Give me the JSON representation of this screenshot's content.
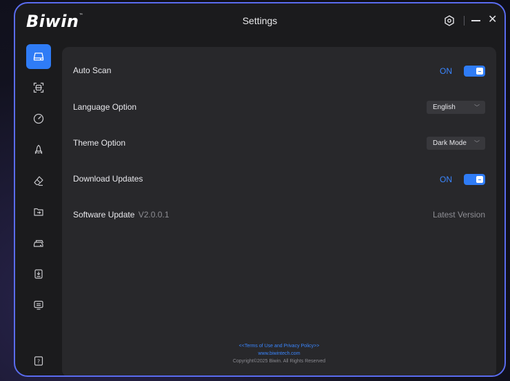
{
  "app": {
    "logo": "Biwin",
    "logo_tm": "™",
    "title": "Settings"
  },
  "titlebar": {
    "gear_icon": "gear-icon",
    "minimize_label": "—",
    "close_label": "✕"
  },
  "sidebar": {
    "items": [
      {
        "icon": "drive-icon",
        "active": true
      },
      {
        "icon": "scan-icon",
        "active": false
      },
      {
        "icon": "speed-gauge-icon",
        "active": false
      },
      {
        "icon": "rocket-icon",
        "active": false
      },
      {
        "icon": "eraser-icon",
        "active": false
      },
      {
        "icon": "folder-transfer-icon",
        "active": false
      },
      {
        "icon": "drive-clone-icon",
        "active": false
      },
      {
        "icon": "firmware-icon",
        "active": false
      },
      {
        "icon": "monitor-icon",
        "active": false
      }
    ],
    "help_icon": "help-icon",
    "help_label": "?"
  },
  "settings": {
    "auto_scan": {
      "label": "Auto Scan",
      "state": "ON",
      "enabled": true
    },
    "language": {
      "label": "Language Option",
      "value": "English",
      "chevron": "﹀"
    },
    "theme": {
      "label": "Theme Option",
      "value": "Dark Mode",
      "chevron": "﹀"
    },
    "download_updates": {
      "label": "Download Updates",
      "state": "ON",
      "enabled": true
    },
    "software_update": {
      "label": "Software Update",
      "version": "V2.0.0.1",
      "status": "Latest Version"
    }
  },
  "footer": {
    "terms": "<<Terms of Use and Privacy Policy>>",
    "website": "www.biwintech.com",
    "copyright": "Copyright©2025 Biwin. All Rights Reserved"
  },
  "colors": {
    "accent": "#2f7cf6",
    "border": "#5a6cf0",
    "panel": "#28282b",
    "window": "#1b1b1d"
  }
}
